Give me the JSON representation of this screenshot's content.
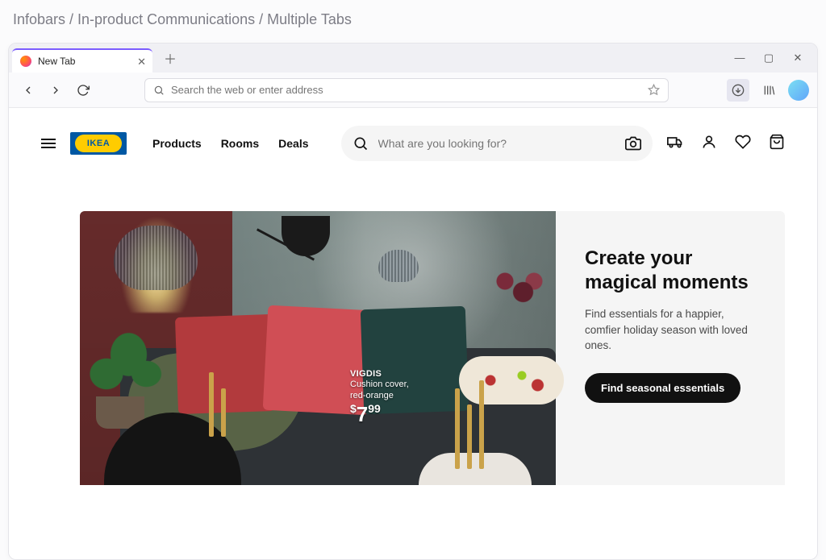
{
  "page_title": "Infobars / In-product Communications / Multiple Tabs",
  "browser": {
    "tab": {
      "label": "New Tab"
    },
    "urlbar": {
      "placeholder": "Search the web or enter address"
    }
  },
  "site": {
    "logo_text": "IKEA",
    "nav": {
      "products": "Products",
      "rooms": "Rooms",
      "deals": "Deals"
    },
    "search_placeholder": "What are you looking for?"
  },
  "hero": {
    "product": {
      "name": "VIGDIS",
      "desc_line1": "Cushion cover,",
      "desc_line2": "red-orange",
      "currency": "$",
      "price_whole": "7",
      "price_cents": "99"
    },
    "title": "Create your magical moments",
    "body": "Find essentials for a happier, comfier holiday season with loved ones.",
    "cta": "Find seasonal essentials"
  }
}
